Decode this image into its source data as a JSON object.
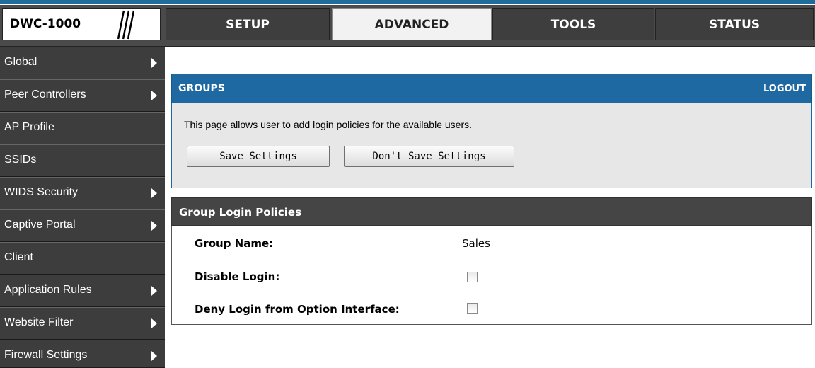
{
  "header": {
    "logo": "DWC-1000",
    "tabs": [
      {
        "label": "SETUP"
      },
      {
        "label": "ADVANCED"
      },
      {
        "label": "TOOLS"
      },
      {
        "label": "STATUS"
      }
    ],
    "active_tab": "ADVANCED"
  },
  "sidebar": {
    "items": [
      {
        "label": "Global",
        "has_arrow": true
      },
      {
        "label": "Peer Controllers",
        "has_arrow": true
      },
      {
        "label": "AP Profile",
        "has_arrow": false
      },
      {
        "label": "SSIDs",
        "has_arrow": false
      },
      {
        "label": "WIDS Security",
        "has_arrow": true
      },
      {
        "label": "Captive Portal",
        "has_arrow": true
      },
      {
        "label": "Client",
        "has_arrow": false
      },
      {
        "label": "Application Rules",
        "has_arrow": true
      },
      {
        "label": "Website Filter",
        "has_arrow": true
      },
      {
        "label": "Firewall Settings",
        "has_arrow": true
      }
    ]
  },
  "groups": {
    "title": "GROUPS",
    "logout": "LOGOUT",
    "description": "This page allows user to add login policies for the available users.",
    "save_label": "Save Settings",
    "dont_save_label": "Don't Save Settings"
  },
  "policies": {
    "title": "Group Login Policies",
    "group_name_label": "Group Name:",
    "group_name_value": "Sales",
    "disable_login_label": "Disable Login:",
    "disable_login_checked": false,
    "deny_login_label": "Deny Login from Option Interface:",
    "deny_login_checked": false
  },
  "colors": {
    "panel_blue": "#1f69a3",
    "dark_bar": "#454545",
    "sidebar_bg": "#3d3d3d",
    "top_stripe": "#1d6c9c"
  }
}
